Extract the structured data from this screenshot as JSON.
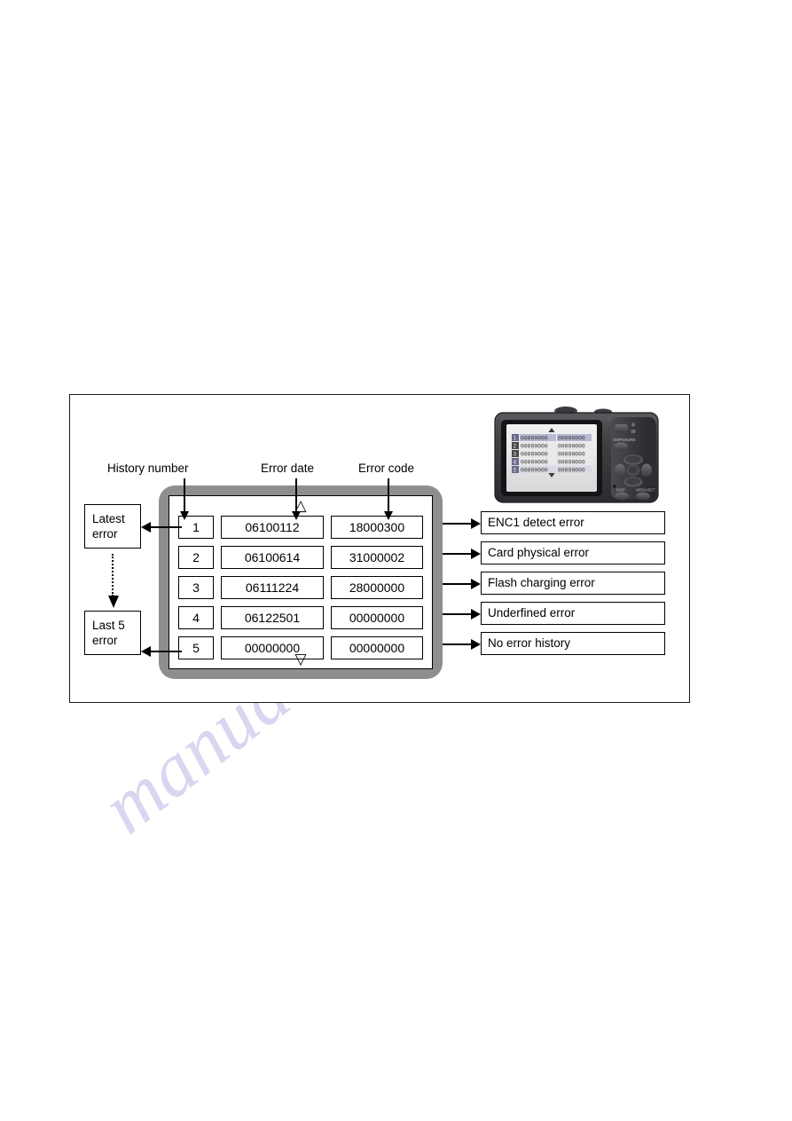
{
  "figure": {
    "captions": {
      "history_number": "History number",
      "error_date": "Error date",
      "error_code": "Error code"
    },
    "side_boxes": {
      "latest": "Latest\nerror",
      "latest_line1": "Latest",
      "latest_line2": "error",
      "last5_line1": "Last 5",
      "last5_line2": "error"
    },
    "screen": {
      "scroll_up_icon": "triangle-up-icon",
      "scroll_down_icon": "triangle-down-icon",
      "scroll_up_glyph": "△",
      "scroll_down_glyph": "▽"
    },
    "table": {
      "columns": [
        "History number",
        "Error date",
        "Error code"
      ],
      "rows": [
        {
          "number": "1",
          "date": "06100112",
          "code": "18000300",
          "description": "ENC1 detect error"
        },
        {
          "number": "2",
          "date": "06100614",
          "code": "31000002",
          "description": "Card physical error"
        },
        {
          "number": "3",
          "date": "06111224",
          "code": "28000000",
          "description": "Flash charging error"
        },
        {
          "number": "4",
          "date": "06122501",
          "code": "00000000",
          "description": "Underfined error"
        },
        {
          "number": "5",
          "date": "00000000",
          "code": "00000000",
          "description": "No error history"
        }
      ]
    },
    "camera": {
      "label_exposure": "EXPOSURE",
      "label_display": "DISP",
      "label_menu": "MENU/SET",
      "lcd_rows": [
        "1",
        "2",
        "3",
        "4",
        "5"
      ],
      "lcd_digits": "00000000"
    },
    "colors": {
      "bezel": "#8e8e8e",
      "frame_border": "#1a1a1a",
      "watermark": "#b9b6e4",
      "camera_body": "#3c3c3e"
    }
  },
  "watermark": {
    "text": "manualsarchive.com"
  }
}
